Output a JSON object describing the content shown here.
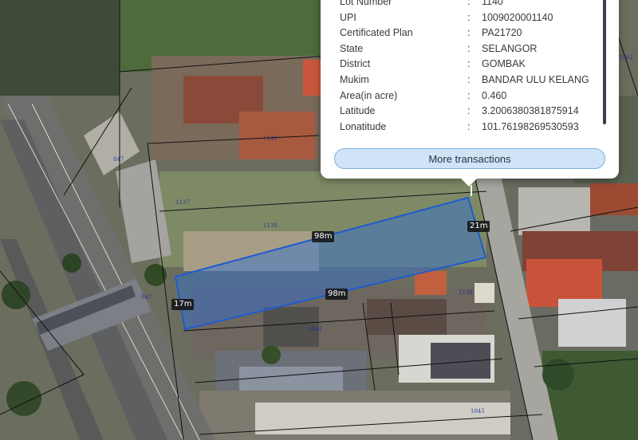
{
  "map": {
    "measurements": {
      "top_length": "98m",
      "bottom_length": "98m",
      "right_width": "21m",
      "left_width": "17m"
    },
    "lot_labels": [
      "1140",
      "1139",
      "1138",
      "1044",
      "1045",
      "1062",
      "1137",
      "847",
      "847"
    ],
    "colors": {
      "parcel_fill": "#2f6fd6",
      "parcel_stroke": "#1f5bd0",
      "boundary": "#111111"
    }
  },
  "popup": {
    "fields": [
      {
        "label": "Lot Number",
        "sep": ":",
        "value": "1140"
      },
      {
        "label": "UPI",
        "sep": ":",
        "value": "1009020001140"
      },
      {
        "label": "Certificated Plan",
        "sep": ":",
        "value": "PA21720"
      },
      {
        "label": "State",
        "sep": ":",
        "value": "SELANGOR"
      },
      {
        "label": "District",
        "sep": ":",
        "value": "GOMBAK"
      },
      {
        "label": "Mukim",
        "sep": ":",
        "value": "BANDAR ULU KELANG"
      },
      {
        "label": "Area(in acre)",
        "sep": ":",
        "value": "0.460"
      },
      {
        "label": "Latitude",
        "sep": ":",
        "value": "3.2006380381875914"
      },
      {
        "label": "Lonatitude",
        "sep": ":",
        "value": "101.76198269530593"
      }
    ],
    "more_button_label": "More transactions"
  }
}
